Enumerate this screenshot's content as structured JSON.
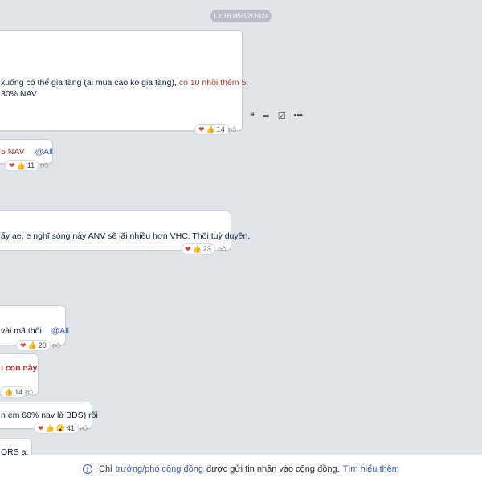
{
  "timestamp": "13:16 05/12/2024",
  "messages": [
    {
      "line1_a": "xuống có thể gia tăng (ai mua cao ko gia tăng), ",
      "line1_b": "có 10 nhồi thêm 5.",
      "line2": "30% NAV",
      "reaction_count": "14"
    },
    {
      "text_a": "5 NAV",
      "mention": "@All",
      "reaction_count": "11"
    },
    {
      "text": "ấy ae, e nghĩ sóng này ANV sẽ lãi nhiều hơn VHC. Thôi tuỳ duyên.",
      "reaction_count": "23"
    },
    {
      "text": "vài mã thôi.",
      "mention": "@All",
      "reaction_count": "20"
    },
    {
      "text": "ı con này",
      "reaction_count": "14"
    },
    {
      "text": "n em 60% nav là BĐS) rồi",
      "reaction_count": "41"
    },
    {
      "text": "ORS a."
    }
  ],
  "toolbar": {
    "quote_icon": "quote-icon",
    "forward_icon": "forward-icon",
    "task_icon": "task-icon",
    "more_icon": "more-icon"
  },
  "footer": {
    "prefix": "Chỉ",
    "roles_link": "trưởng/phó cộng đồng",
    "middle": "được gửi tin nhắn vào cộng đồng.",
    "learn_more": "Tìm hiểu thêm"
  },
  "colors": {
    "background": "#e1e4e9",
    "bubble_border": "#c9cede",
    "highlight_red": "#b1342e",
    "mention_blue": "#3d5bb7"
  }
}
